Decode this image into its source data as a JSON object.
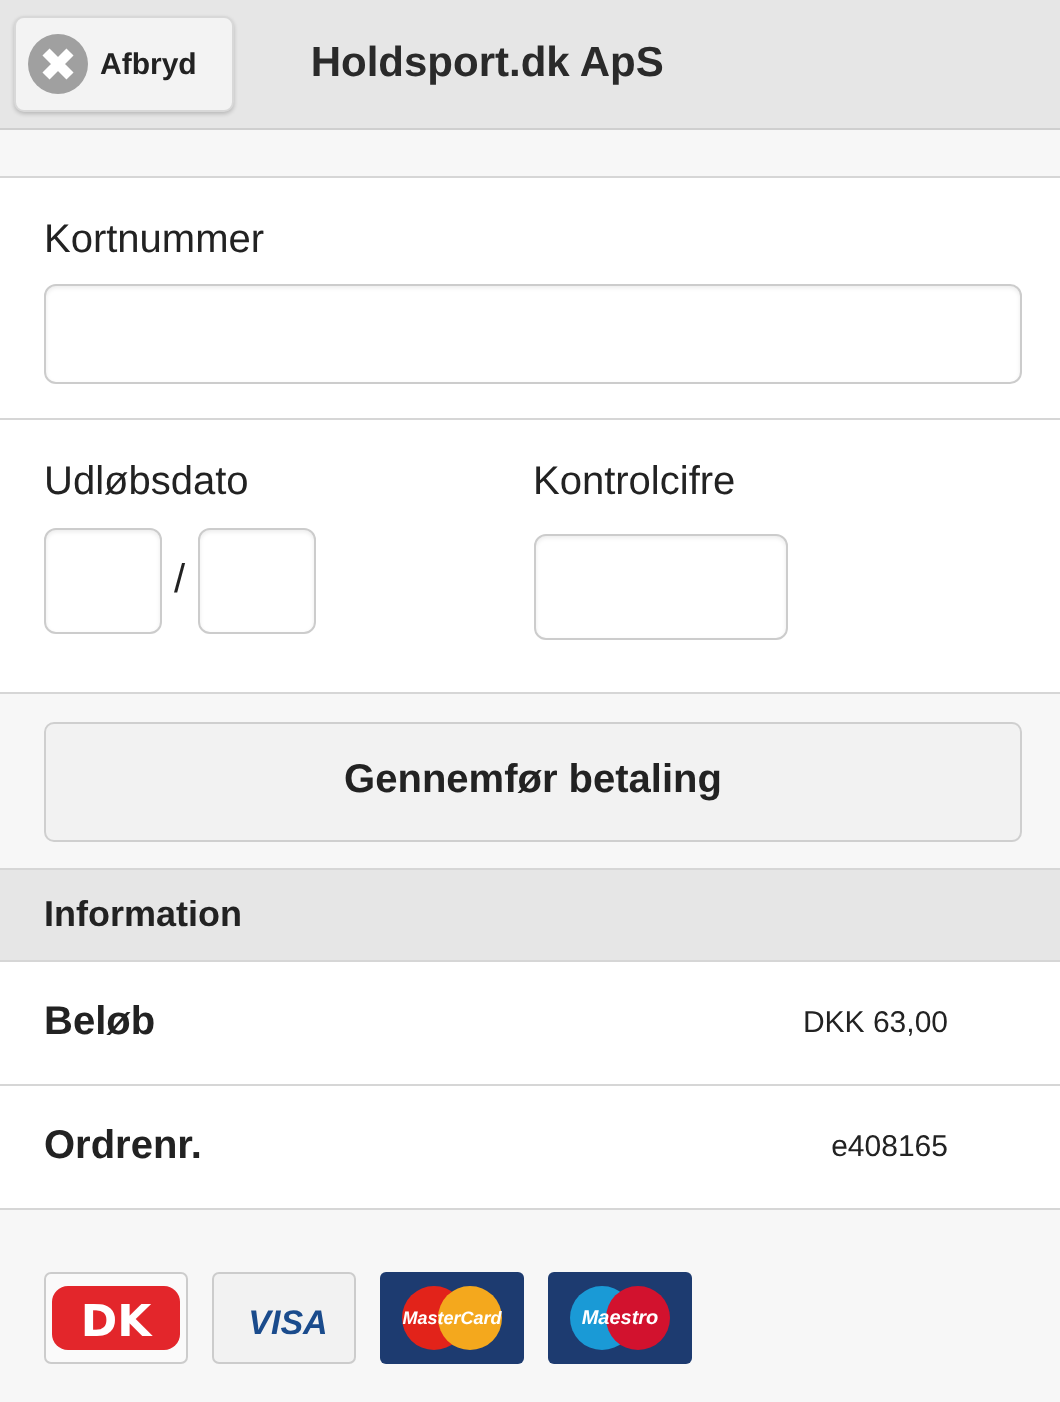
{
  "header": {
    "cancel_button": "Afbryd",
    "title": "Holdsport.dk ApS"
  },
  "card_number": {
    "label": "Kortnummer"
  },
  "expiry": {
    "label": "Udløbsdato",
    "separator": "/"
  },
  "cvc": {
    "label": "Kontrolcifre"
  },
  "pay_button": "Gennemfør betaling",
  "info": {
    "heading": "Information",
    "rows": [
      {
        "label": "Beløb",
        "value": "DKK 63,00"
      },
      {
        "label": "Ordrenr.",
        "value": "e408165"
      }
    ]
  },
  "cards": [
    {
      "kind": "dk",
      "text": "DK"
    },
    {
      "kind": "visa",
      "text": "VISA"
    },
    {
      "kind": "mastercard",
      "text": "MasterCard"
    },
    {
      "kind": "maestro",
      "text": "Maestro"
    }
  ]
}
